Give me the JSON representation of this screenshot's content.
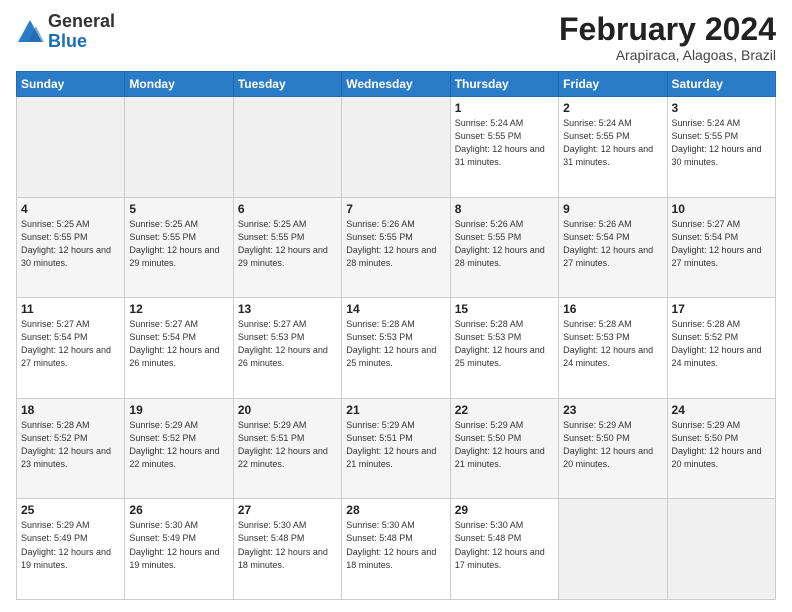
{
  "header": {
    "logo_general": "General",
    "logo_blue": "Blue",
    "month_title": "February 2024",
    "location": "Arapiraca, Alagoas, Brazil"
  },
  "weekdays": [
    "Sunday",
    "Monday",
    "Tuesday",
    "Wednesday",
    "Thursday",
    "Friday",
    "Saturday"
  ],
  "weeks": [
    [
      {
        "day": "",
        "sunrise": "",
        "sunset": "",
        "daylight": "",
        "empty": true
      },
      {
        "day": "",
        "sunrise": "",
        "sunset": "",
        "daylight": "",
        "empty": true
      },
      {
        "day": "",
        "sunrise": "",
        "sunset": "",
        "daylight": "",
        "empty": true
      },
      {
        "day": "",
        "sunrise": "",
        "sunset": "",
        "daylight": "",
        "empty": true
      },
      {
        "day": "1",
        "sunrise": "Sunrise: 5:24 AM",
        "sunset": "Sunset: 5:55 PM",
        "daylight": "Daylight: 12 hours and 31 minutes.",
        "empty": false
      },
      {
        "day": "2",
        "sunrise": "Sunrise: 5:24 AM",
        "sunset": "Sunset: 5:55 PM",
        "daylight": "Daylight: 12 hours and 31 minutes.",
        "empty": false
      },
      {
        "day": "3",
        "sunrise": "Sunrise: 5:24 AM",
        "sunset": "Sunset: 5:55 PM",
        "daylight": "Daylight: 12 hours and 30 minutes.",
        "empty": false
      }
    ],
    [
      {
        "day": "4",
        "sunrise": "Sunrise: 5:25 AM",
        "sunset": "Sunset: 5:55 PM",
        "daylight": "Daylight: 12 hours and 30 minutes.",
        "empty": false
      },
      {
        "day": "5",
        "sunrise": "Sunrise: 5:25 AM",
        "sunset": "Sunset: 5:55 PM",
        "daylight": "Daylight: 12 hours and 29 minutes.",
        "empty": false
      },
      {
        "day": "6",
        "sunrise": "Sunrise: 5:25 AM",
        "sunset": "Sunset: 5:55 PM",
        "daylight": "Daylight: 12 hours and 29 minutes.",
        "empty": false
      },
      {
        "day": "7",
        "sunrise": "Sunrise: 5:26 AM",
        "sunset": "Sunset: 5:55 PM",
        "daylight": "Daylight: 12 hours and 28 minutes.",
        "empty": false
      },
      {
        "day": "8",
        "sunrise": "Sunrise: 5:26 AM",
        "sunset": "Sunset: 5:55 PM",
        "daylight": "Daylight: 12 hours and 28 minutes.",
        "empty": false
      },
      {
        "day": "9",
        "sunrise": "Sunrise: 5:26 AM",
        "sunset": "Sunset: 5:54 PM",
        "daylight": "Daylight: 12 hours and 27 minutes.",
        "empty": false
      },
      {
        "day": "10",
        "sunrise": "Sunrise: 5:27 AM",
        "sunset": "Sunset: 5:54 PM",
        "daylight": "Daylight: 12 hours and 27 minutes.",
        "empty": false
      }
    ],
    [
      {
        "day": "11",
        "sunrise": "Sunrise: 5:27 AM",
        "sunset": "Sunset: 5:54 PM",
        "daylight": "Daylight: 12 hours and 27 minutes.",
        "empty": false
      },
      {
        "day": "12",
        "sunrise": "Sunrise: 5:27 AM",
        "sunset": "Sunset: 5:54 PM",
        "daylight": "Daylight: 12 hours and 26 minutes.",
        "empty": false
      },
      {
        "day": "13",
        "sunrise": "Sunrise: 5:27 AM",
        "sunset": "Sunset: 5:53 PM",
        "daylight": "Daylight: 12 hours and 26 minutes.",
        "empty": false
      },
      {
        "day": "14",
        "sunrise": "Sunrise: 5:28 AM",
        "sunset": "Sunset: 5:53 PM",
        "daylight": "Daylight: 12 hours and 25 minutes.",
        "empty": false
      },
      {
        "day": "15",
        "sunrise": "Sunrise: 5:28 AM",
        "sunset": "Sunset: 5:53 PM",
        "daylight": "Daylight: 12 hours and 25 minutes.",
        "empty": false
      },
      {
        "day": "16",
        "sunrise": "Sunrise: 5:28 AM",
        "sunset": "Sunset: 5:53 PM",
        "daylight": "Daylight: 12 hours and 24 minutes.",
        "empty": false
      },
      {
        "day": "17",
        "sunrise": "Sunrise: 5:28 AM",
        "sunset": "Sunset: 5:52 PM",
        "daylight": "Daylight: 12 hours and 24 minutes.",
        "empty": false
      }
    ],
    [
      {
        "day": "18",
        "sunrise": "Sunrise: 5:28 AM",
        "sunset": "Sunset: 5:52 PM",
        "daylight": "Daylight: 12 hours and 23 minutes.",
        "empty": false
      },
      {
        "day": "19",
        "sunrise": "Sunrise: 5:29 AM",
        "sunset": "Sunset: 5:52 PM",
        "daylight": "Daylight: 12 hours and 22 minutes.",
        "empty": false
      },
      {
        "day": "20",
        "sunrise": "Sunrise: 5:29 AM",
        "sunset": "Sunset: 5:51 PM",
        "daylight": "Daylight: 12 hours and 22 minutes.",
        "empty": false
      },
      {
        "day": "21",
        "sunrise": "Sunrise: 5:29 AM",
        "sunset": "Sunset: 5:51 PM",
        "daylight": "Daylight: 12 hours and 21 minutes.",
        "empty": false
      },
      {
        "day": "22",
        "sunrise": "Sunrise: 5:29 AM",
        "sunset": "Sunset: 5:50 PM",
        "daylight": "Daylight: 12 hours and 21 minutes.",
        "empty": false
      },
      {
        "day": "23",
        "sunrise": "Sunrise: 5:29 AM",
        "sunset": "Sunset: 5:50 PM",
        "daylight": "Daylight: 12 hours and 20 minutes.",
        "empty": false
      },
      {
        "day": "24",
        "sunrise": "Sunrise: 5:29 AM",
        "sunset": "Sunset: 5:50 PM",
        "daylight": "Daylight: 12 hours and 20 minutes.",
        "empty": false
      }
    ],
    [
      {
        "day": "25",
        "sunrise": "Sunrise: 5:29 AM",
        "sunset": "Sunset: 5:49 PM",
        "daylight": "Daylight: 12 hours and 19 minutes.",
        "empty": false
      },
      {
        "day": "26",
        "sunrise": "Sunrise: 5:30 AM",
        "sunset": "Sunset: 5:49 PM",
        "daylight": "Daylight: 12 hours and 19 minutes.",
        "empty": false
      },
      {
        "day": "27",
        "sunrise": "Sunrise: 5:30 AM",
        "sunset": "Sunset: 5:48 PM",
        "daylight": "Daylight: 12 hours and 18 minutes.",
        "empty": false
      },
      {
        "day": "28",
        "sunrise": "Sunrise: 5:30 AM",
        "sunset": "Sunset: 5:48 PM",
        "daylight": "Daylight: 12 hours and 18 minutes.",
        "empty": false
      },
      {
        "day": "29",
        "sunrise": "Sunrise: 5:30 AM",
        "sunset": "Sunset: 5:48 PM",
        "daylight": "Daylight: 12 hours and 17 minutes.",
        "empty": false
      },
      {
        "day": "",
        "sunrise": "",
        "sunset": "",
        "daylight": "",
        "empty": true
      },
      {
        "day": "",
        "sunrise": "",
        "sunset": "",
        "daylight": "",
        "empty": true
      }
    ]
  ]
}
